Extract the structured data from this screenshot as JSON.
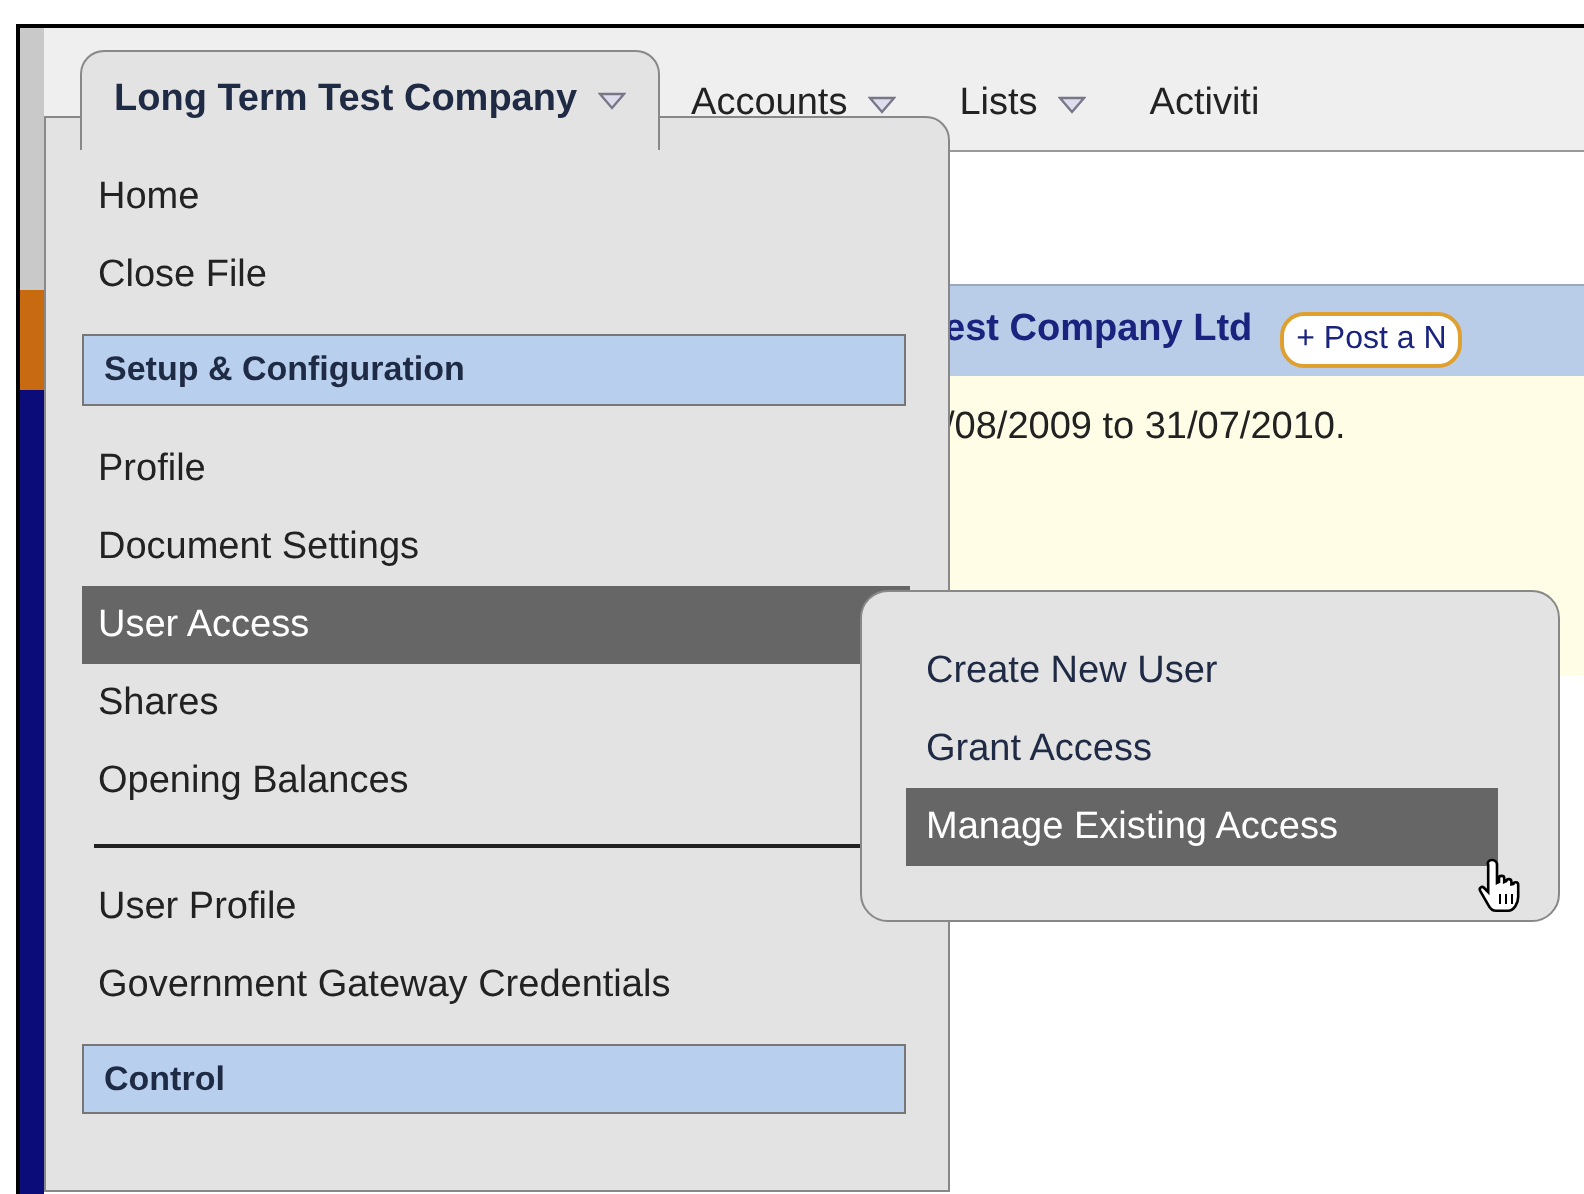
{
  "nav": {
    "tabs": [
      {
        "label": "Long Term Test Company",
        "selected": true,
        "has_menu": true
      },
      {
        "label": "Accounts",
        "selected": false,
        "has_menu": true
      },
      {
        "label": "Lists",
        "selected": false,
        "has_menu": true
      },
      {
        "label": "Activiti",
        "selected": false,
        "has_menu": false
      }
    ]
  },
  "content": {
    "title": "est Company Ltd",
    "post_button": "+ Post a N",
    "period": "/08/2009 to 31/07/2010."
  },
  "menu": {
    "items": [
      {
        "kind": "item",
        "label": "Home",
        "selected": false
      },
      {
        "kind": "item",
        "label": "Close File",
        "selected": false
      },
      {
        "kind": "header",
        "label": "Setup & Configuration"
      },
      {
        "kind": "item",
        "label": "Profile",
        "selected": false
      },
      {
        "kind": "item",
        "label": "Document Settings",
        "selected": false
      },
      {
        "kind": "item",
        "label": "User Access",
        "selected": true
      },
      {
        "kind": "item",
        "label": "Shares",
        "selected": false
      },
      {
        "kind": "item",
        "label": "Opening Balances",
        "selected": false
      },
      {
        "kind": "divider"
      },
      {
        "kind": "item",
        "label": "User Profile",
        "selected": false
      },
      {
        "kind": "item",
        "label": "Government Gateway Credentials",
        "selected": false
      },
      {
        "kind": "header",
        "label": "Control"
      }
    ]
  },
  "submenu": {
    "items": [
      {
        "label": "Create New User",
        "selected": false
      },
      {
        "label": "Grant Access",
        "selected": false
      },
      {
        "label": "Manage Existing Access",
        "selected": true
      }
    ]
  }
}
